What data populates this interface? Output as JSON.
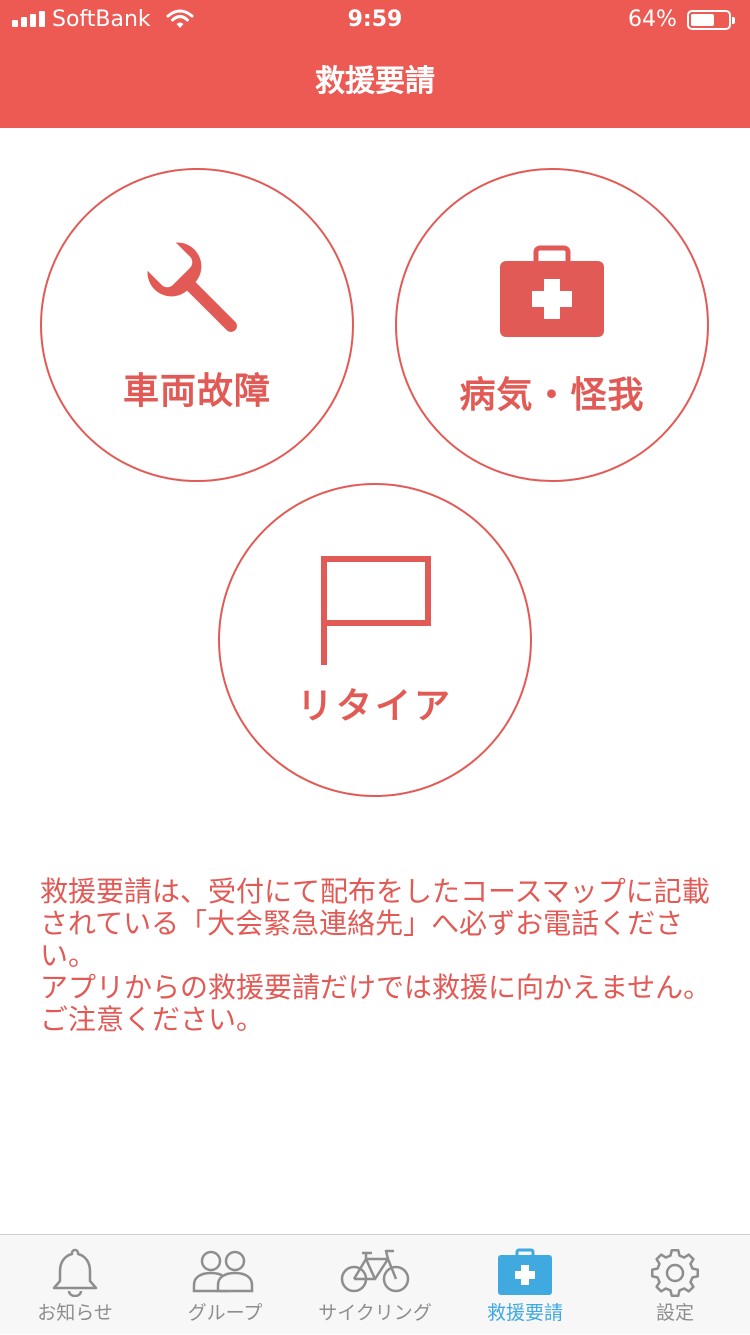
{
  "status_bar": {
    "carrier": "SoftBank",
    "time": "9:59",
    "battery_percent_text": "64%",
    "battery_level": 0.64
  },
  "header": {
    "title": "救援要請",
    "background_color": "#EC5A53"
  },
  "buttons": {
    "breakdown": {
      "label": "車両故障",
      "icon": "wrench-icon"
    },
    "illness": {
      "label": "病気・怪我",
      "icon": "first-aid-kit-icon"
    },
    "retire": {
      "label": "リタイア",
      "icon": "flag-icon"
    }
  },
  "notice": {
    "line1": "救援要請は、受付にて配布をしたコースマップに記載されている「大会緊急連絡先」へ必ずお電話ください。",
    "line2": "アプリからの救援要請だけでは救援に向かえません。ご注意ください。",
    "color": "#E25A55"
  },
  "tabbar": {
    "active_color": "#3FA9E0",
    "inactive_color": "#8E8E8E",
    "tabs": [
      {
        "label": "お知らせ",
        "icon": "bell-icon"
      },
      {
        "label": "グループ",
        "icon": "group-icon"
      },
      {
        "label": "サイクリング",
        "icon": "bicycle-icon"
      },
      {
        "label": "救援要請",
        "icon": "first-aid-kit-icon",
        "active": true
      },
      {
        "label": "設定",
        "icon": "gear-icon"
      }
    ]
  }
}
